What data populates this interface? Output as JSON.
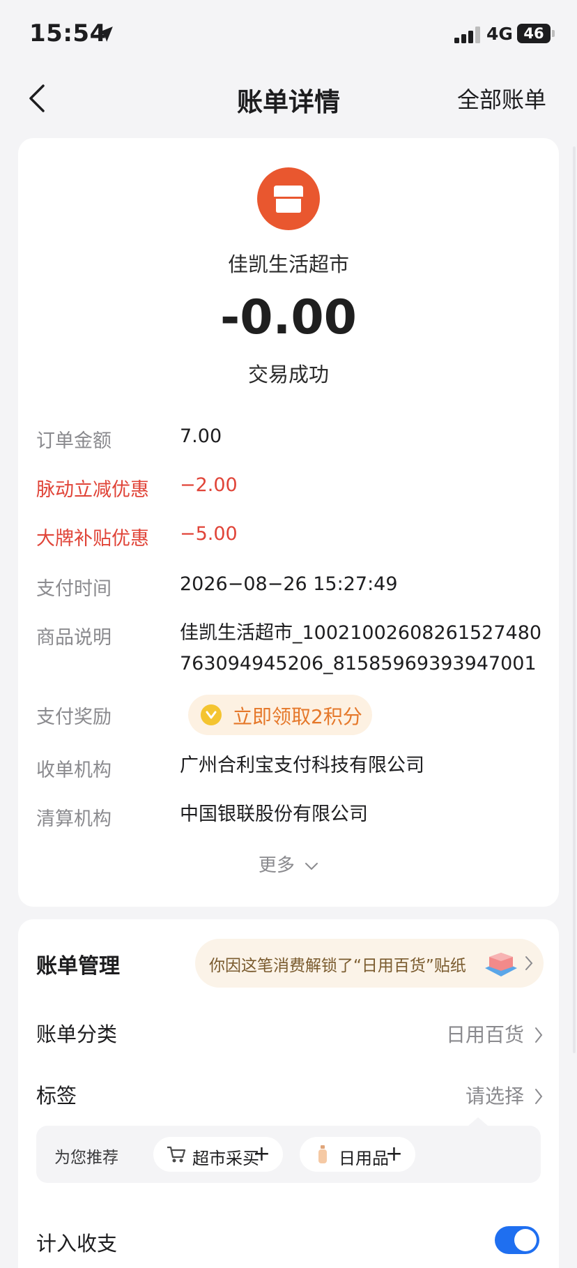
{
  "status_bar": {
    "time": "15:54",
    "network": "4G",
    "battery": "46"
  },
  "nav": {
    "title": "账单详情",
    "right_link": "全部账单"
  },
  "bill": {
    "merchant": "佳凯生活超市",
    "amount": "-0.00",
    "status": "交易成功",
    "details": [
      {
        "label": "订单金额",
        "value": "7.00"
      },
      {
        "label": "脉动立减优惠",
        "value": "−2.00"
      },
      {
        "label": "大牌补贴优惠",
        "value": "−5.00"
      },
      {
        "label": "支付时间",
        "value": "2026−08−26 15:27:49"
      },
      {
        "label": "商品说明",
        "value_line1": "佳凯生活超市_1002100260826152748​0",
        "value_line2": "763094945206_815859693939​47001"
      },
      {
        "label": "支付奖励",
        "value": "立即领取2积分"
      },
      {
        "label": "收单机构",
        "value": "广州合利宝支付科技有限公司"
      },
      {
        "label": "清算机构",
        "value": "中国银联股份有限公司"
      }
    ],
    "more": "更多"
  },
  "management": {
    "title": "账单管理",
    "sticker_banner": "你因这笔消费解锁了“日用百货”贴纸",
    "category": {
      "label": "账单分类",
      "value": "日用百货"
    },
    "tags": {
      "label": "标签",
      "value": "请选择"
    },
    "recommend": {
      "label": "为您推荐",
      "chips": [
        {
          "text": "超市采买",
          "icon": "shopping-cart-icon"
        },
        {
          "text": "日用品",
          "icon": "lotion-bottle-icon"
        }
      ]
    },
    "include": {
      "label": "计入收支",
      "enabled": true
    }
  },
  "colors": {
    "accent_blue": "#1f6ff0",
    "discount_red": "#e04438",
    "merchant_orange": "#e9572f",
    "reward_orange": "#e5782a"
  }
}
